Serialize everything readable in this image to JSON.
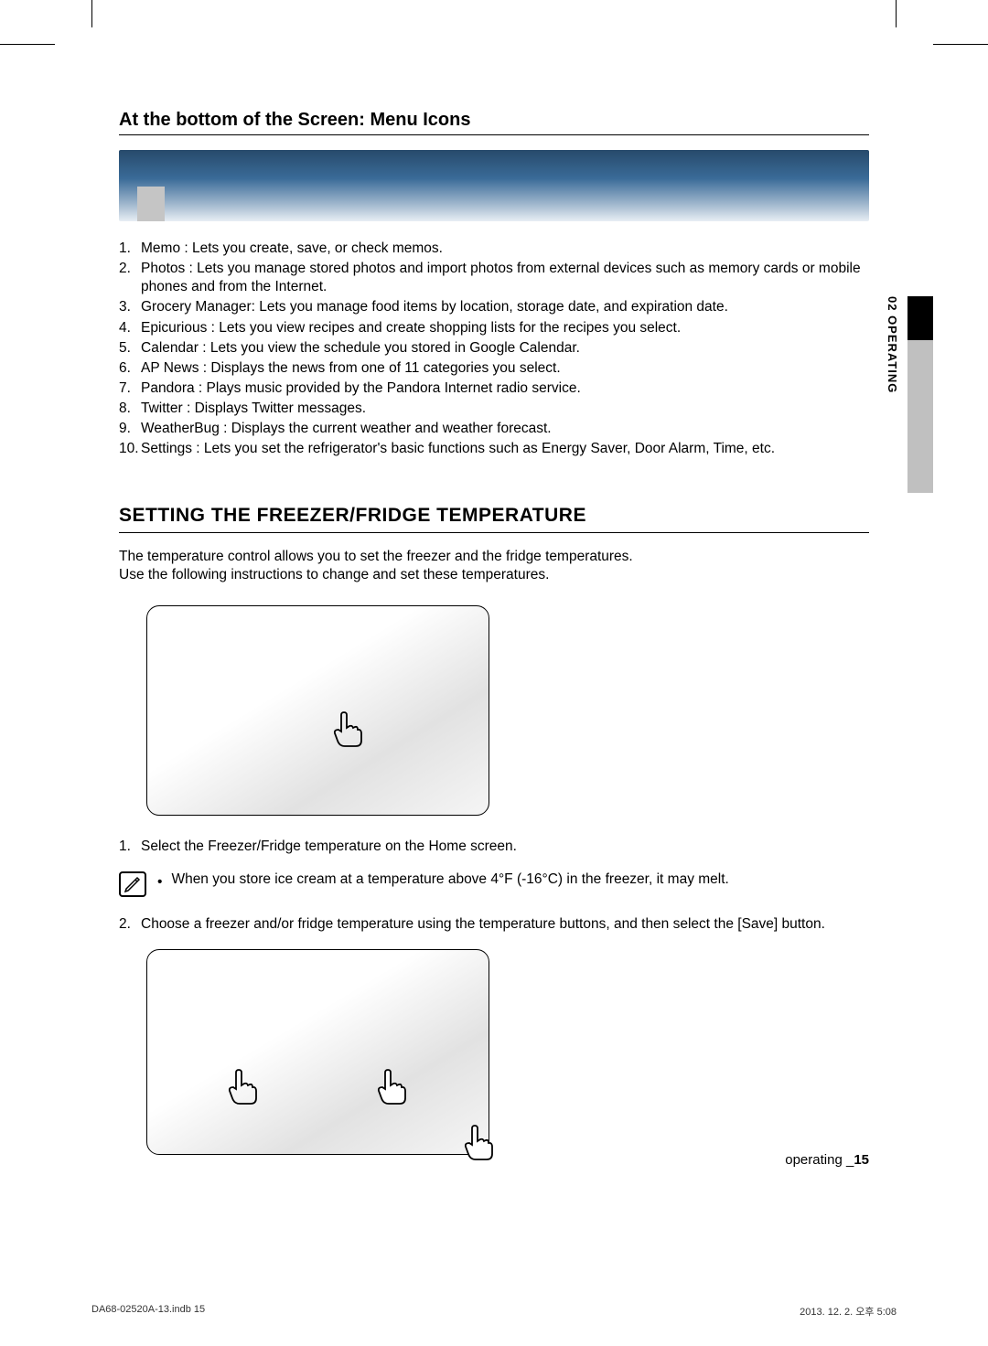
{
  "sectionTitle1": "At the bottom of the Screen: Menu Icons",
  "menuItems": [
    "Memo : Lets you create, save, or check memos.",
    "Photos : Lets you manage stored photos and import photos from external devices such as memory cards or mobile phones and from the Internet.",
    "Grocery Manager: Lets you manage food items by location, storage date, and expiration date.",
    "Epicurious : Lets you view recipes and create shopping lists for the recipes you select.",
    "Calendar : Lets you view the schedule you stored in Google Calendar.",
    "AP News : Displays the news from one of 11 categories you select.",
    "Pandora : Plays music provided by the Pandora Internet radio service.",
    "Twitter : Displays Twitter messages.",
    "WeatherBug : Displays the current weather and weather forecast.",
    "Settings : Lets you set the refrigerator's basic functions such as Energy Saver, Door Alarm, Time, etc."
  ],
  "mainHeading": "SETTING THE FREEZER/FRIDGE TEMPERATURE",
  "introLines": [
    "The temperature control allows you to set the freezer and the fridge temperatures.",
    "Use the following instructions to change and set these temperatures."
  ],
  "step1": "Select the Freezer/Fridge temperature on the Home screen.",
  "noteText": "When you store ice cream at a temperature above 4°F (-16°C) in the freezer, it may melt.",
  "step2": "Choose a freezer and/or fridge temperature using the temperature buttons, and then select the [Save] button.",
  "sideTab": "02  OPERATING",
  "footerText": "operating _",
  "pageNum": "15",
  "printLeft": "DA68-02520A-13.indb   15",
  "printRight": "2013. 12. 2.   오후 5:08"
}
